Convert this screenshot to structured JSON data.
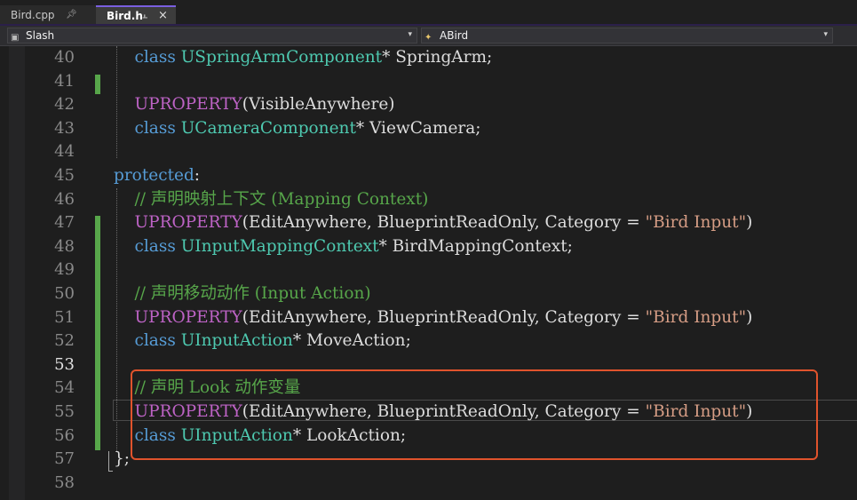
{
  "tabs": [
    {
      "label": "Bird.cpp",
      "pin_icon": "pin-icon"
    },
    {
      "label": "Bird.h",
      "pin_icon": "pin-icon",
      "close_glyph": "×",
      "active": true
    }
  ],
  "navbar": {
    "project_label": "Slash",
    "scope_label": "ABird"
  },
  "editor": {
    "current_line": "53",
    "lines": [
      {
        "num": "40",
        "segs": [
          {
            "t": "    "
          },
          {
            "t": "class",
            "c": "kw"
          },
          {
            "t": " "
          },
          {
            "t": "USpringArmComponent",
            "c": "ty"
          },
          {
            "t": "* SpringArm;"
          }
        ]
      },
      {
        "num": "41",
        "segs": []
      },
      {
        "num": "42",
        "segs": [
          {
            "t": "    "
          },
          {
            "t": "UPROPERTY",
            "c": "mac"
          },
          {
            "t": "(VisibleAnywhere)"
          }
        ]
      },
      {
        "num": "43",
        "segs": [
          {
            "t": "    "
          },
          {
            "t": "class",
            "c": "kw"
          },
          {
            "t": " "
          },
          {
            "t": "UCameraComponent",
            "c": "ty"
          },
          {
            "t": "* ViewCamera;"
          }
        ]
      },
      {
        "num": "44",
        "segs": []
      },
      {
        "num": "45",
        "segs": [
          {
            "t": "protected",
            "c": "kw"
          },
          {
            "t": ":"
          }
        ]
      },
      {
        "num": "46",
        "segs": [
          {
            "t": "    "
          },
          {
            "t": "// 声明映射上下文 (Mapping Context)",
            "c": "com"
          }
        ]
      },
      {
        "num": "47",
        "segs": [
          {
            "t": "    "
          },
          {
            "t": "UPROPERTY",
            "c": "mac"
          },
          {
            "t": "(EditAnywhere, BlueprintReadOnly, Category = "
          },
          {
            "t": "\"Bird Input\"",
            "c": "str"
          },
          {
            "t": ")"
          }
        ]
      },
      {
        "num": "48",
        "segs": [
          {
            "t": "    "
          },
          {
            "t": "class",
            "c": "kw"
          },
          {
            "t": " "
          },
          {
            "t": "UInputMappingContext",
            "c": "ty"
          },
          {
            "t": "* BirdMappingContext;"
          }
        ]
      },
      {
        "num": "49",
        "segs": []
      },
      {
        "num": "50",
        "segs": [
          {
            "t": "    "
          },
          {
            "t": "// 声明移动动作 (Input Action)",
            "c": "com"
          }
        ]
      },
      {
        "num": "51",
        "segs": [
          {
            "t": "    "
          },
          {
            "t": "UPROPERTY",
            "c": "mac"
          },
          {
            "t": "(EditAnywhere, BlueprintReadOnly, Category = "
          },
          {
            "t": "\"Bird Input\"",
            "c": "str"
          },
          {
            "t": ")"
          }
        ]
      },
      {
        "num": "52",
        "segs": [
          {
            "t": "    "
          },
          {
            "t": "class",
            "c": "kw"
          },
          {
            "t": " "
          },
          {
            "t": "UInputAction",
            "c": "ty"
          },
          {
            "t": "* MoveAction;"
          }
        ]
      },
      {
        "num": "53",
        "segs": []
      },
      {
        "num": "54",
        "segs": [
          {
            "t": "    "
          },
          {
            "t": "// 声明 Look 动作变量",
            "c": "com"
          }
        ]
      },
      {
        "num": "55",
        "segs": [
          {
            "t": "    "
          },
          {
            "t": "UPROPERTY",
            "c": "mac"
          },
          {
            "t": "(EditAnywhere, BlueprintReadOnly, Category = "
          },
          {
            "t": "\"Bird Input\"",
            "c": "str"
          },
          {
            "t": ")"
          }
        ]
      },
      {
        "num": "56",
        "segs": [
          {
            "t": "    "
          },
          {
            "t": "class",
            "c": "kw"
          },
          {
            "t": " "
          },
          {
            "t": "UInputAction",
            "c": "ty"
          },
          {
            "t": "* LookAction;"
          }
        ]
      },
      {
        "num": "57",
        "segs": [
          {
            "t": "};"
          }
        ]
      },
      {
        "num": "58",
        "segs": []
      }
    ]
  },
  "colors": {
    "keyword": "#569cd6",
    "type": "#4ec9b0",
    "macro": "#bd63c5",
    "string": "#d69d85",
    "comment": "#57a64a",
    "highlight_box": "#e0532c"
  }
}
